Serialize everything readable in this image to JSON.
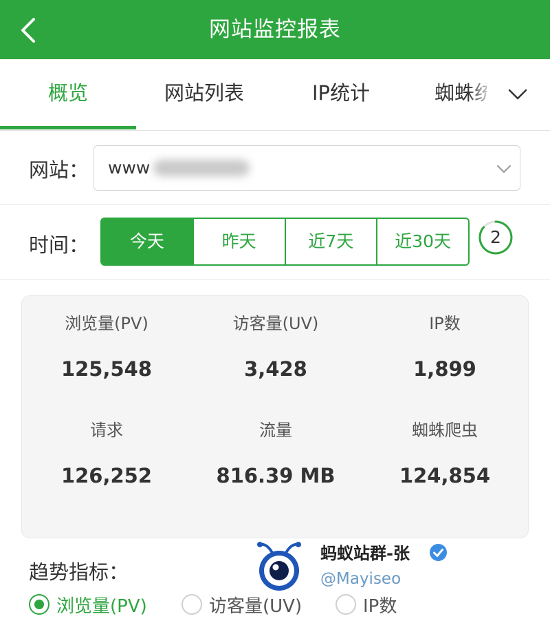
{
  "header": {
    "title": "网站监控报表"
  },
  "tabs": [
    {
      "label": "概览",
      "active": true
    },
    {
      "label": "网站列表",
      "active": false
    },
    {
      "label": "IP统计",
      "active": false
    },
    {
      "label": "蜘蛛统",
      "active": false
    }
  ],
  "site": {
    "label": "网站：",
    "value": "www"
  },
  "time": {
    "label": "时间：",
    "ranges": [
      {
        "label": "今天",
        "active": true
      },
      {
        "label": "昨天",
        "active": false
      },
      {
        "label": "近7天",
        "active": false
      },
      {
        "label": "近30天",
        "active": false
      }
    ],
    "refresh_count": "2"
  },
  "stats": [
    {
      "label": "浏览量(PV)",
      "value": "125,548"
    },
    {
      "label": "访客量(UV)",
      "value": "3,428"
    },
    {
      "label": "IP数",
      "value": "1,899"
    },
    {
      "label": "请求",
      "value": "126,252"
    },
    {
      "label": "流量",
      "value": "816.39 MB"
    },
    {
      "label": "蜘蛛爬虫",
      "value": "124,854"
    }
  ],
  "trend": {
    "label": "趋势指标：",
    "options": [
      {
        "label": "浏览量(PV)",
        "checked": true
      },
      {
        "label": "访客量(UV)",
        "checked": false
      },
      {
        "label": "IP数",
        "checked": false
      }
    ]
  },
  "watermark": {
    "name": "蚂蚁站群-张",
    "handle": "@Mayiseo"
  },
  "colors": {
    "primary": "#2ea63f",
    "card_bg": "#f5f5f5",
    "text": "#333333"
  }
}
